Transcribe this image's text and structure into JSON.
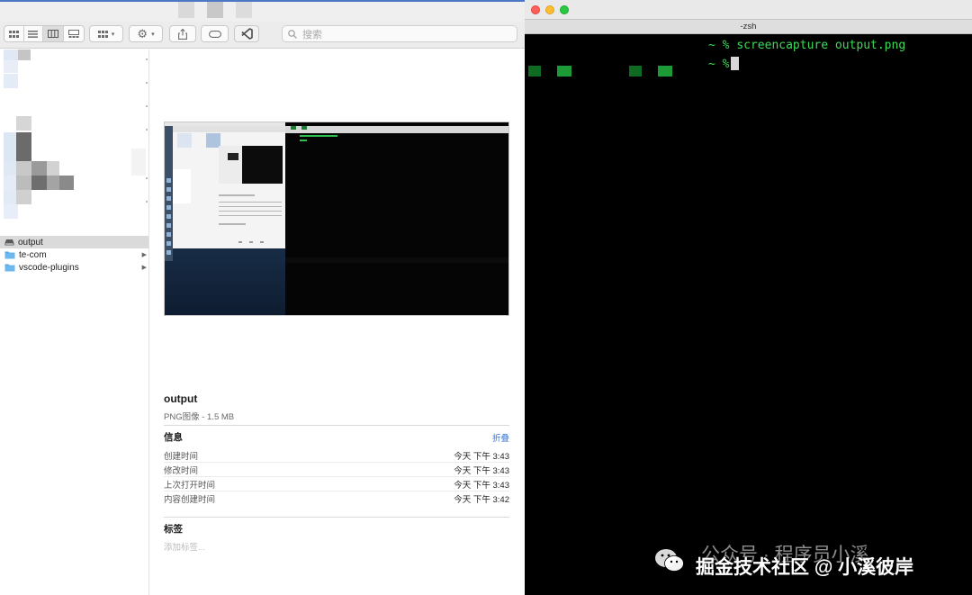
{
  "finder": {
    "search": {
      "placeholder": "搜索"
    },
    "sidebar": {
      "items": [
        {
          "label": "output",
          "icon": "drive-icon",
          "selected": true
        },
        {
          "label": "te-com",
          "icon": "folder-icon",
          "selected": false
        },
        {
          "label": "vscode-plugins",
          "icon": "folder-icon",
          "selected": false
        }
      ]
    },
    "preview": {
      "file_name": "output",
      "file_type": "PNG图像 - 1.5 MB",
      "info_title": "信息",
      "collapse_label": "折叠",
      "rows": [
        {
          "label": "创建时间",
          "value": "今天 下午 3:43"
        },
        {
          "label": "修改时间",
          "value": "今天 下午 3:43"
        },
        {
          "label": "上次打开时间",
          "value": "今天 下午 3:43"
        },
        {
          "label": "内容创建时间",
          "value": "今天 下午 3:42"
        }
      ],
      "tags_title": "标签",
      "tags_placeholder": "添加标签..."
    },
    "colors": {
      "accent": "#2e72d8",
      "selected_row": "#dadada"
    }
  },
  "terminal": {
    "title": "-zsh",
    "lines": [
      {
        "prompt": "~ %",
        "command": "screencapture output.png"
      },
      {
        "prompt": "~ %",
        "command": ""
      }
    ],
    "colors": {
      "text": "#3ddc57",
      "background": "#000000"
    }
  },
  "watermark": {
    "line1": "公众号 · 程序员小溪",
    "line2": "掘金技术社区 @ 小溪彼岸"
  }
}
